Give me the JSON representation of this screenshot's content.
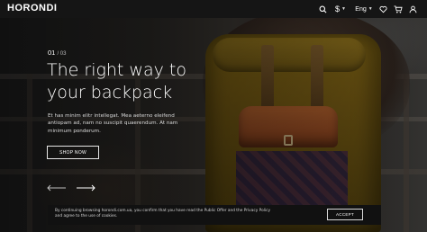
{
  "header": {
    "logo": "HORONDI",
    "currency_symbol": "$",
    "language": "Eng",
    "icons": [
      "search-icon",
      "currency-icon",
      "language-selector",
      "heart-icon",
      "cart-icon",
      "user-icon"
    ]
  },
  "slide": {
    "current": "01",
    "total": "/ 03",
    "title_line1": "The right way to",
    "title_line2": "your backpack",
    "description_line1": "Et has minim elitr intellegat. Mea aeterno eleifend",
    "description_line2": "antiopam ad, nam no suscipit quaerendum. At nam",
    "description_line3": "minimum ponderum.",
    "button_label": "SHOP NOW"
  },
  "cookie_banner": {
    "text_line1": "By continuing browsing horondi.com.ua, you confirm that you have read the Public Offer and the Privacy Policy",
    "text_line2": "and agree to the use of cookies.",
    "accept_label": "ACCEPT"
  },
  "colors": {
    "header_bg": "#151515",
    "cookie_bg": "#111111",
    "text_primary": "#ffffff",
    "text_secondary": "#dcdcdc"
  }
}
